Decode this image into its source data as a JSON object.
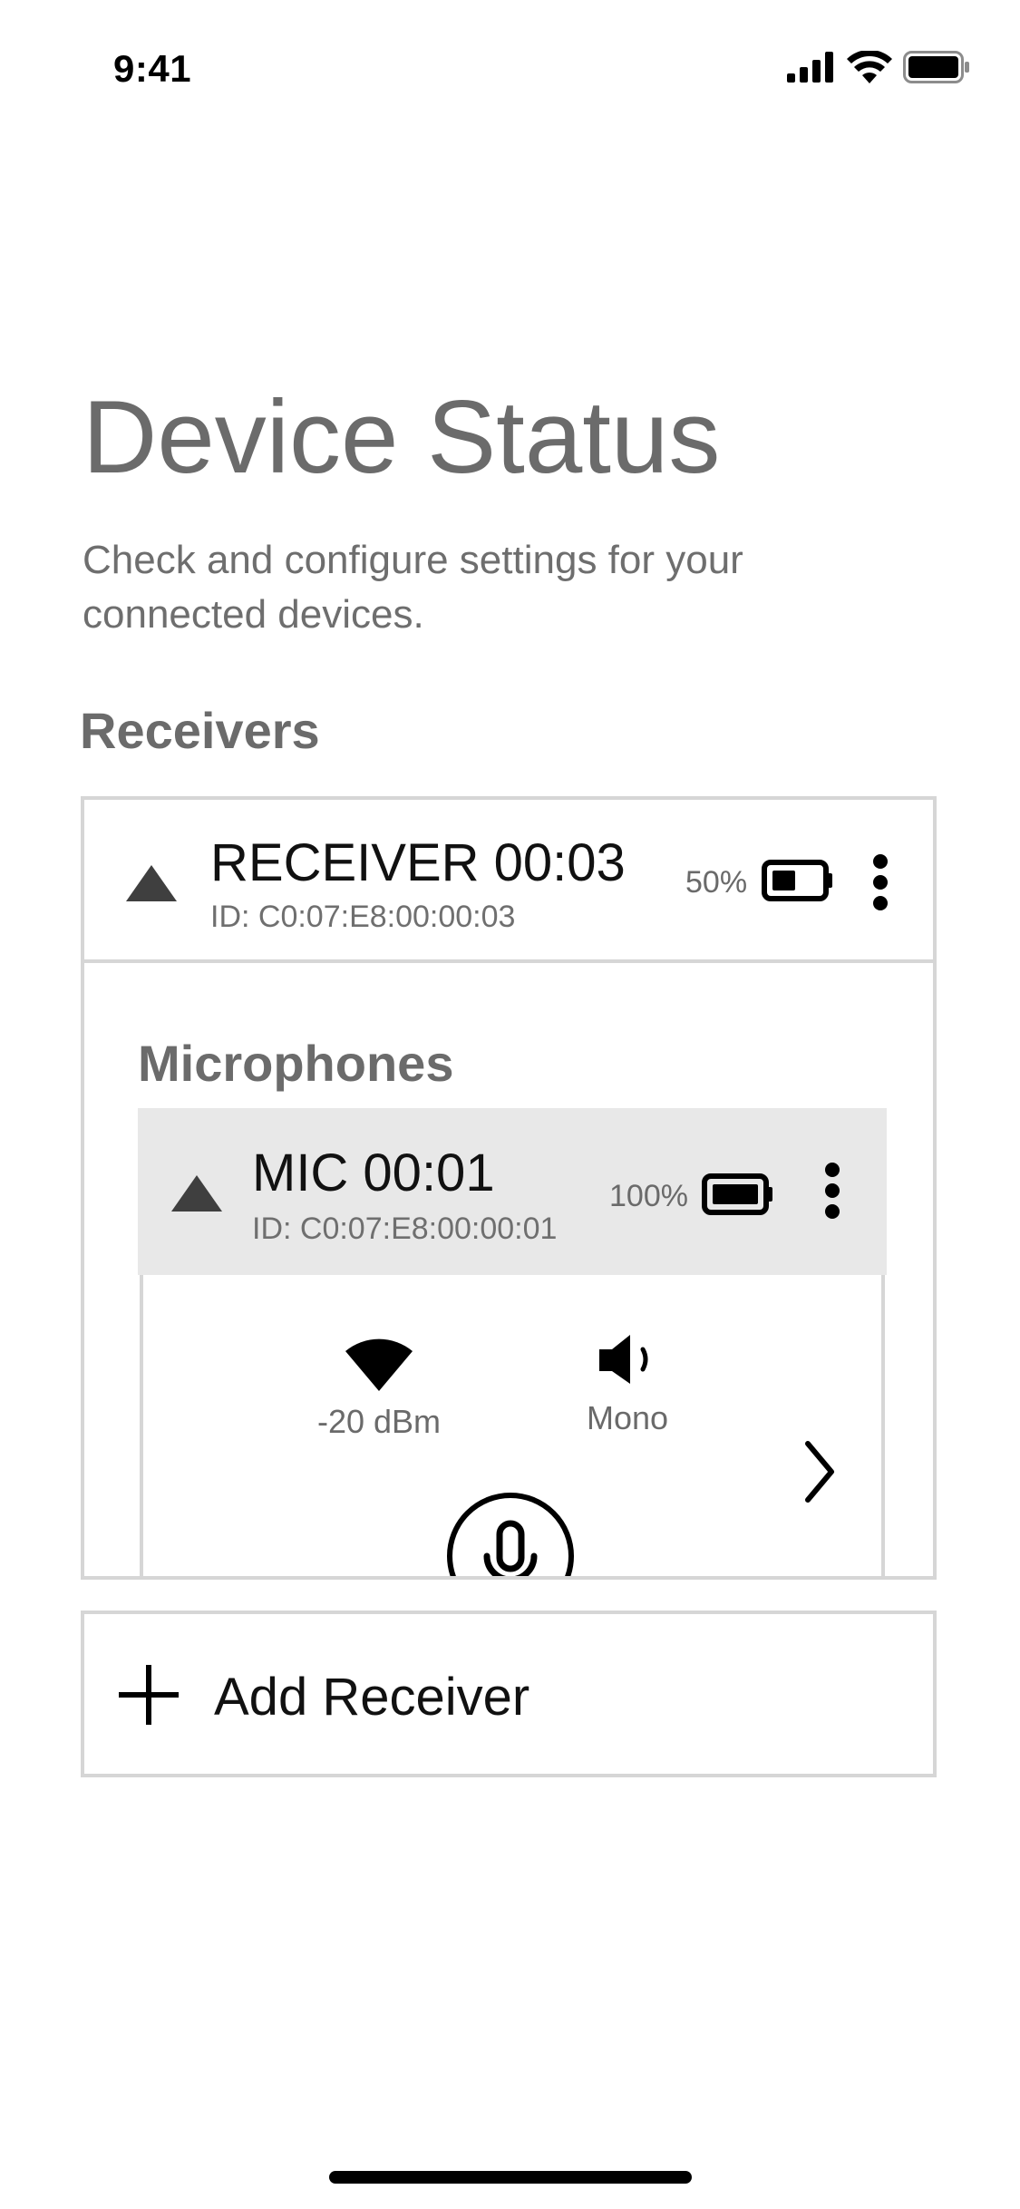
{
  "status_bar": {
    "time": "9:41",
    "icons": [
      "cellular-signal-icon",
      "wifi-icon",
      "battery-icon"
    ]
  },
  "header": {
    "title": "Device Status",
    "subtitle": "Check and configure settings for your connected devices."
  },
  "receivers_section": {
    "heading": "Receivers",
    "receivers": [
      {
        "name": "RECEIVER 00:03",
        "id": "ID: C0:07:E8:00:00:03",
        "battery": "50%",
        "battery_level": 0.5,
        "icons": [
          "collapse-triangle-icon",
          "battery-icon",
          "more-options-icon"
        ],
        "microphones_heading": "Microphones",
        "microphones": [
          {
            "name": "MIC 00:01",
            "id": "ID: C0:07:E8:00:00:01",
            "battery": "100%",
            "battery_level": 1.0,
            "signal": "-20 dBm",
            "channel_mode": "Mono",
            "icons": [
              "collapse-triangle-icon",
              "battery-icon",
              "more-options-icon",
              "wifi-signal-icon",
              "speaker-icon",
              "chevron-right-icon",
              "microphone-icon"
            ]
          }
        ]
      }
    ]
  },
  "add_receiver": {
    "label": "Add Receiver",
    "icon": "plus-icon"
  },
  "colors": {
    "card_border": "#d6d6d6",
    "mic_header_bg": "#e8e8e8",
    "heading_gray": "#6b6b6b",
    "text_dark": "#111111"
  }
}
